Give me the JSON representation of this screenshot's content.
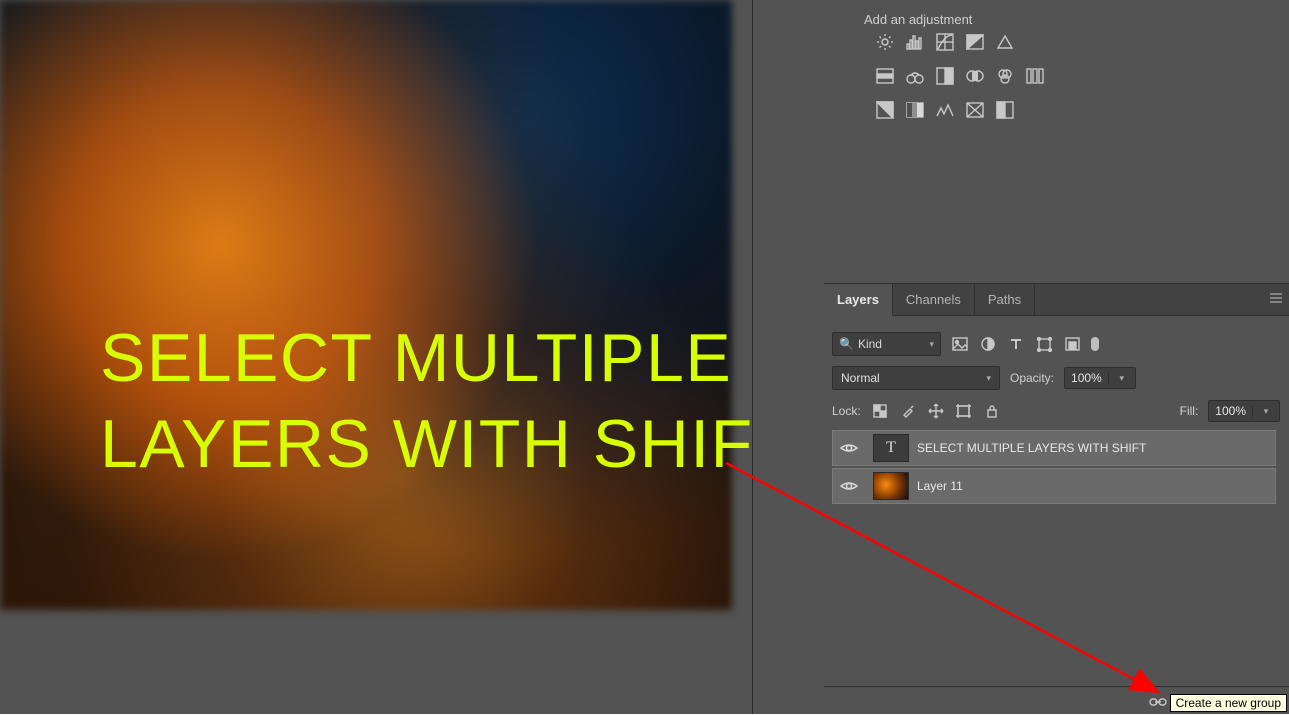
{
  "canvas": {
    "overlay_text": "SELECT MULTIPLE\nLAYERS WITH SHIFT"
  },
  "adjustments": {
    "title": "Add an adjustment",
    "icons": [
      [
        "brightness-contrast",
        "levels",
        "curves",
        "exposure",
        "threshold"
      ],
      [
        "vibrance",
        "hue-saturation",
        "color-balance",
        "black-white",
        "photo-filter",
        "channel-mixer",
        "color-lookup"
      ],
      [
        "invert",
        "posterize",
        "threshold2",
        "gradient-map",
        "selective-color"
      ]
    ]
  },
  "tabs": {
    "layers": "Layers",
    "channels": "Channels",
    "paths": "Paths",
    "active": "layers"
  },
  "filter": {
    "mode_label": "Kind"
  },
  "blend": {
    "mode": "Normal",
    "opacity_label": "Opacity:",
    "opacity_val": "100%"
  },
  "lock": {
    "label": "Lock:",
    "fill_label": "Fill:",
    "fill_val": "100%"
  },
  "layers": [
    {
      "name": "SELECT MULTIPLE LAYERS WITH SHIFT",
      "type": "text",
      "selected": true,
      "visible": true
    },
    {
      "name": "Layer 11",
      "type": "image",
      "selected": true,
      "visible": true
    }
  ],
  "tooltip": "Create a new group"
}
